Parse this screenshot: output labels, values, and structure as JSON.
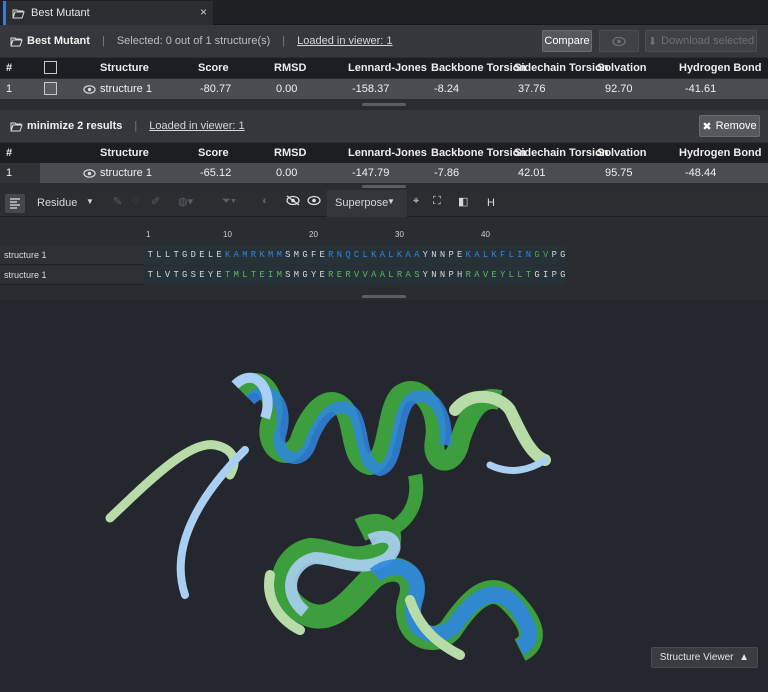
{
  "tab": {
    "label": "Best Mutant",
    "close": "×"
  },
  "panel1": {
    "title": "Best Mutant",
    "selected": "Selected: 0 out of 1 structure(s)",
    "loaded": "Loaded in viewer: 1",
    "compare": "Compare",
    "download": "Download selected"
  },
  "columns": [
    "#",
    "Structure",
    "Score",
    "RMSD",
    "Lennard-Jones",
    "Backbone Torsion",
    "Sidechain Torsion",
    "Solvation",
    "Hydrogen Bond"
  ],
  "table1": [
    {
      "idx": "1",
      "structure": "structure 1",
      "score": "-80.77",
      "rmsd": "0.00",
      "lj": "-158.37",
      "bb": "-8.24",
      "sc": "37.76",
      "solv": "92.70",
      "hb": "-41.61"
    }
  ],
  "panel2": {
    "title": "minimize 2 results",
    "loaded": "Loaded in viewer: 1",
    "remove": "Remove"
  },
  "table2": [
    {
      "idx": "1",
      "structure": "structure 1",
      "score": "-65.12",
      "rmsd": "0.00",
      "lj": "-147.79",
      "bb": "-7.86",
      "sc": "42.01",
      "solv": "95.75",
      "hb": "-48.44"
    }
  ],
  "toolbar": {
    "residue": "Residue",
    "superpose": "Superpose",
    "h": "H"
  },
  "ruler": [
    "1",
    "10",
    "20",
    "30",
    "40"
  ],
  "sequences": [
    {
      "label": "structure 1",
      "seq": "TLLTGDELEKAMRKMMSMGFERNQCLKALKAAYNNPEKALKFLINGVPG"
    },
    {
      "label": "structure 1",
      "seq": "TLVTGSEYETMLTEIMSMGYERERVVAALRASYNNPHRAVEYLLTGIPG"
    }
  ],
  "viewer": {
    "button": "Structure Viewer"
  },
  "colors": {
    "blue": "#2f86e0",
    "green": "#3c9e3c",
    "lightblue": "#a9cff2",
    "lightgreen": "#b8dca8"
  }
}
